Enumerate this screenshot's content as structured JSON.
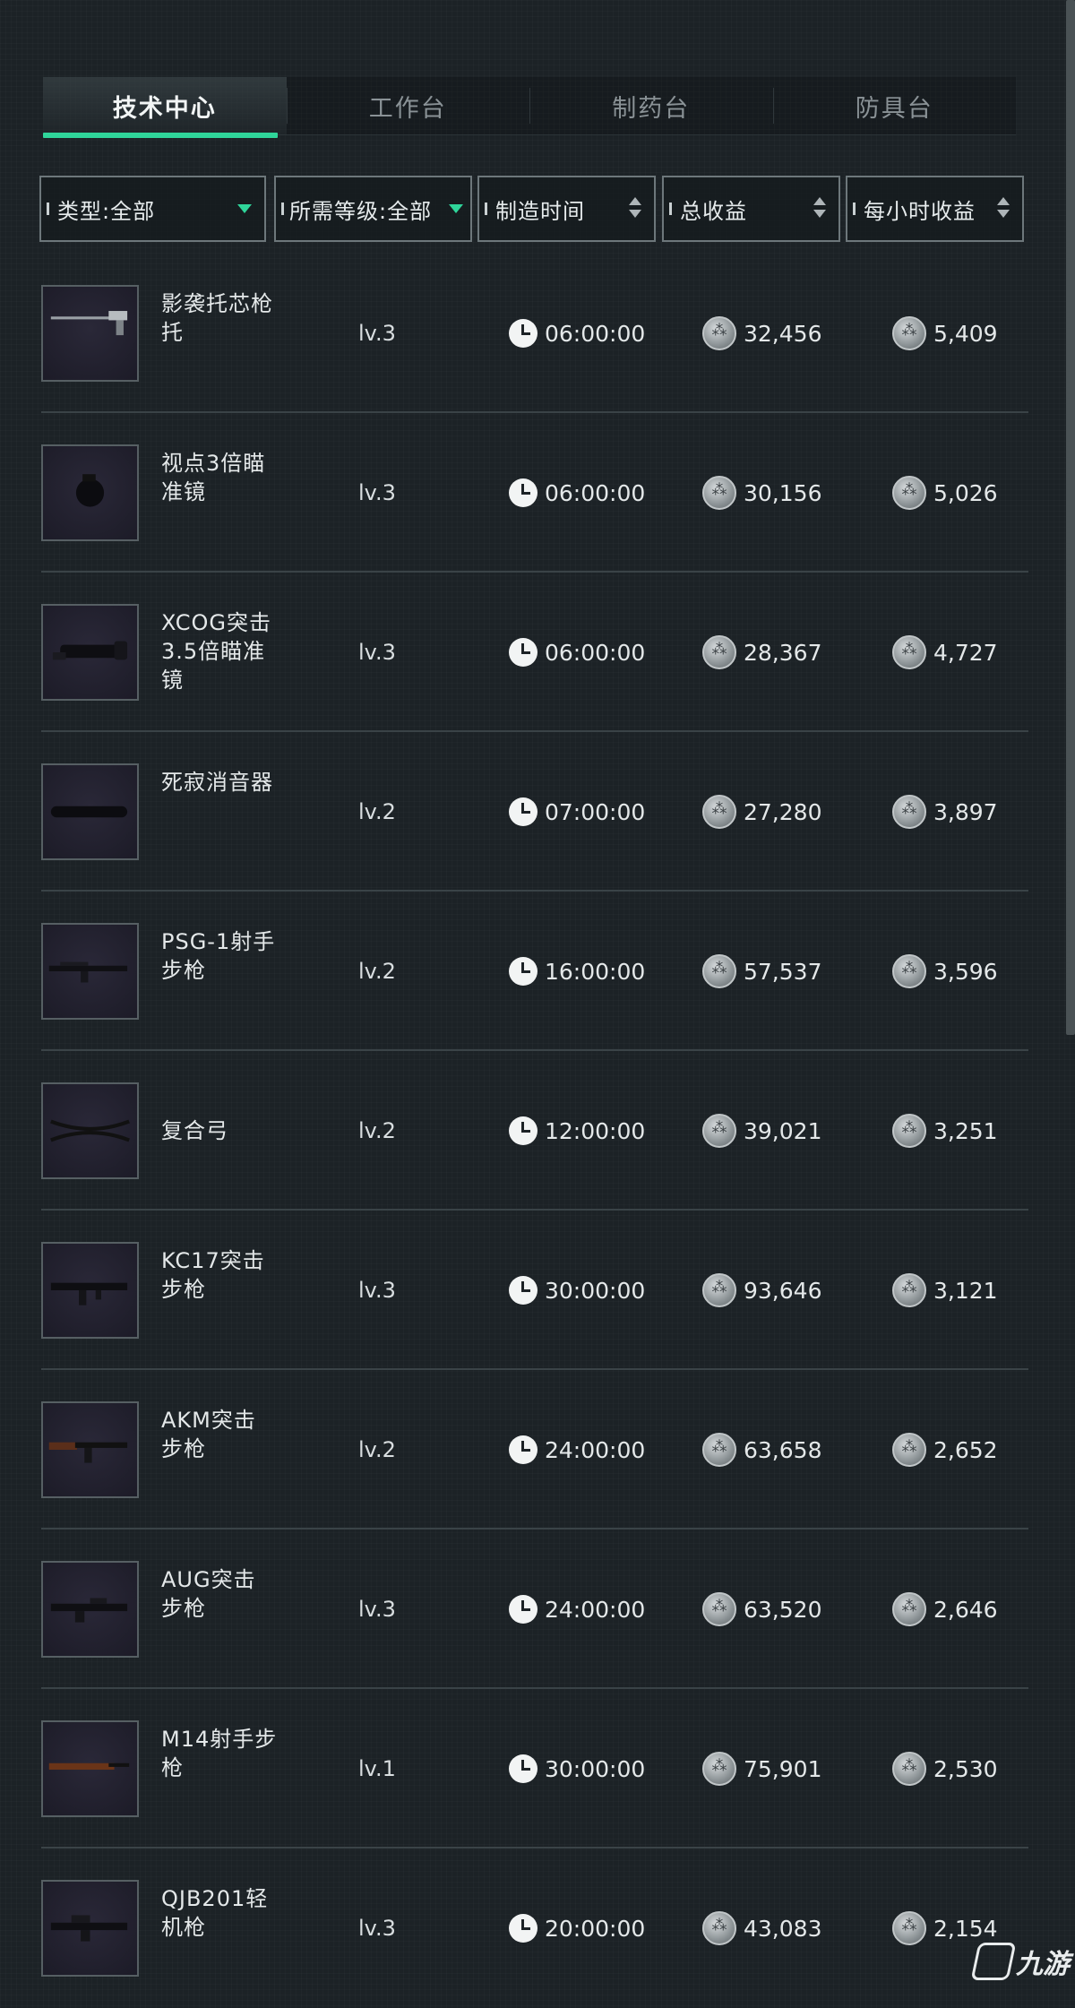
{
  "tabs": [
    {
      "label": "技术中心",
      "active": true
    },
    {
      "label": "工作台",
      "active": false
    },
    {
      "label": "制药台",
      "active": false
    },
    {
      "label": "防具台",
      "active": false
    }
  ],
  "filters": {
    "type": "类型:全部",
    "level": "所需等级:全部",
    "time": "制造时间",
    "total": "总收益",
    "hourly": "每小时收益"
  },
  "accent_color": "#2fd59a",
  "items": [
    {
      "name": "影袭托芯枪托",
      "level": "lv.3",
      "time": "06:00:00",
      "total": "32,456",
      "hourly": "5,409",
      "icon": "stock-icon"
    },
    {
      "name": "视点3倍瞄准镜",
      "level": "lv.3",
      "time": "06:00:00",
      "total": "30,156",
      "hourly": "5,026",
      "icon": "scope-icon"
    },
    {
      "name": "XCOG突击3.5倍瞄准镜",
      "level": "lv.3",
      "time": "06:00:00",
      "total": "28,367",
      "hourly": "4,727",
      "icon": "scope-icon"
    },
    {
      "name": "死寂消音器",
      "level": "lv.2",
      "time": "07:00:00",
      "total": "27,280",
      "hourly": "3,897",
      "icon": "suppressor-icon"
    },
    {
      "name": "PSG-1射手步枪",
      "level": "lv.2",
      "time": "16:00:00",
      "total": "57,537",
      "hourly": "3,596",
      "icon": "rifle-icon"
    },
    {
      "name": "复合弓",
      "level": "lv.2",
      "time": "12:00:00",
      "total": "39,021",
      "hourly": "3,251",
      "icon": "bow-icon"
    },
    {
      "name": "KC17突击步枪",
      "level": "lv.3",
      "time": "30:00:00",
      "total": "93,646",
      "hourly": "3,121",
      "icon": "rifle-icon"
    },
    {
      "name": "AKM突击步枪",
      "level": "lv.2",
      "time": "24:00:00",
      "total": "63,658",
      "hourly": "2,652",
      "icon": "rifle-icon"
    },
    {
      "name": "AUG突击步枪",
      "level": "lv.3",
      "time": "24:00:00",
      "total": "63,520",
      "hourly": "2,646",
      "icon": "rifle-icon"
    },
    {
      "name": "M14射手步枪",
      "level": "lv.1",
      "time": "30:00:00",
      "total": "75,901",
      "hourly": "2,530",
      "icon": "rifle-icon"
    },
    {
      "name": "QJB201轻机枪",
      "level": "lv.3",
      "time": "20:00:00",
      "total": "43,083",
      "hourly": "2,154",
      "icon": "machine-gun-icon"
    }
  ],
  "watermark": "九游"
}
